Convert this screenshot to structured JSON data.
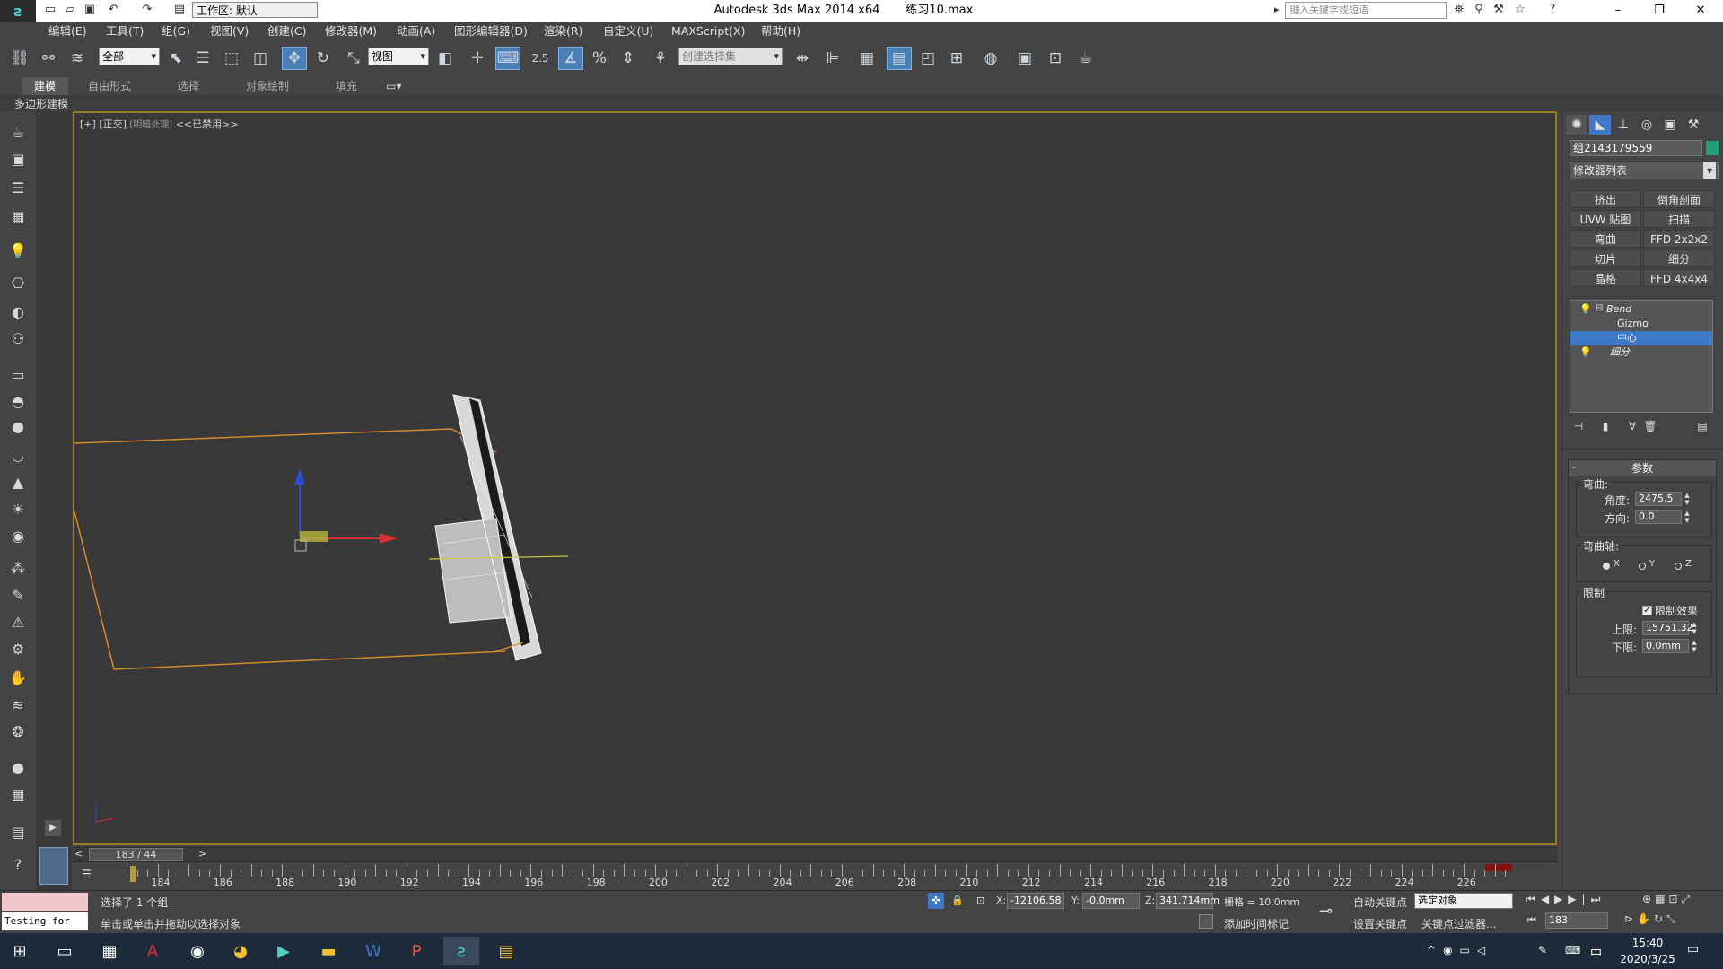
{
  "titlebar": {
    "workspace": "工作区: 默认",
    "app_title": "Autodesk 3ds Max  2014 x64",
    "file_name": "练习10.max",
    "search_placeholder": "键入关键字或短语"
  },
  "menu": [
    "编辑(E)",
    "工具(T)",
    "组(G)",
    "视图(V)",
    "创建(C)",
    "修改器(M)",
    "动画(A)",
    "图形编辑器(D)",
    "渲染(R)",
    "自定义(U)",
    "MAXScript(X)",
    "帮助(H)"
  ],
  "toolbar": {
    "selection_filter": "全部",
    "ref_coord": "视图",
    "snap_value": "2.5",
    "named_selection": "创建选择集"
  },
  "ribbon": {
    "tabs": [
      "建模",
      "自由形式",
      "选择",
      "对象绘制",
      "填充"
    ],
    "active_tab": "建模",
    "sub_label": "多边形建模"
  },
  "viewport": {
    "label_plus": "[+]",
    "label_view": "[正交]",
    "label_shading": "[明暗处理]",
    "label_disabled": "<<已禁用>>"
  },
  "command_panel": {
    "object_name": "组2143179559",
    "object_color": "#1fa173",
    "modifier_list": "修改器列表",
    "modifier_buttons": [
      "挤出",
      "倒角剖面",
      "UVW 贴图",
      "扫描",
      "弯曲",
      "FFD 2x2x2",
      "切片",
      "细分",
      "晶格",
      "FFD 4x4x4"
    ],
    "stack": [
      {
        "label": "Bend",
        "level": 0
      },
      {
        "label": "Gizmo",
        "level": 1
      },
      {
        "label": "中心",
        "level": 1,
        "selected": true
      },
      {
        "label": "细分",
        "level": 0
      }
    ],
    "params": {
      "title": "参数",
      "bend_label": "弯曲:",
      "angle_label": "角度:",
      "angle_value": "2475.5",
      "direction_label": "方向:",
      "direction_value": "0.0",
      "axis_label": "弯曲轴:",
      "axis_x": "X",
      "axis_y": "Y",
      "axis_z": "Z",
      "selected_axis": "X",
      "limits_label": "限制",
      "limit_effect_label": "限制效果",
      "limit_effect_checked": true,
      "upper_label": "上限:",
      "upper_value": "15751.32",
      "lower_label": "下限:",
      "lower_value": "0.0mm"
    }
  },
  "timeline": {
    "frame_display": "183 / 44",
    "ticks": [
      "184",
      "186",
      "188",
      "190",
      "192",
      "194",
      "196",
      "198",
      "200",
      "202",
      "204",
      "206",
      "208",
      "210",
      "212",
      "214",
      "216",
      "218",
      "220",
      "222",
      "224",
      "226"
    ]
  },
  "status": {
    "maxscript_listener": "Testing for ALL",
    "selected_msg": "选择了 1 个组",
    "prompt_msg": "单击或单击并拖动以选择对象",
    "x_label": "X:",
    "x_value": "-12106.58",
    "y_label": "Y:",
    "y_value": "-0.0mm",
    "z_label": "Z:",
    "z_value": "341.714mm",
    "grid": "栅格 = 10.0mm",
    "add_time_tag": "添加时间标记",
    "auto_key": "自动关键点",
    "set_key": "设置关键点",
    "key_mode": "选定对象",
    "key_filters": "关键点过滤器...",
    "frame_field": "183"
  },
  "taskbar": {
    "time": "15:40",
    "date": "2020/3/25",
    "ime": "中"
  }
}
